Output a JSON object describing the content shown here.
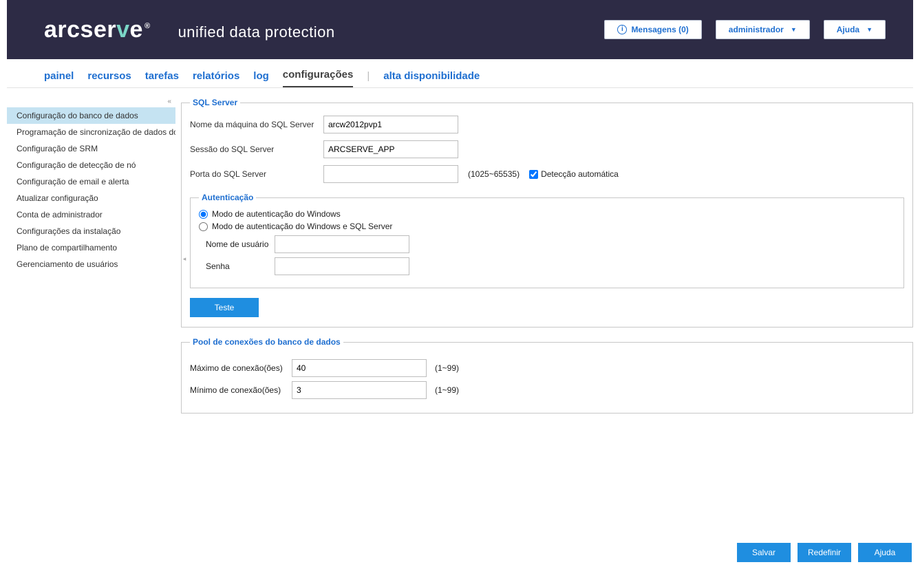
{
  "header": {
    "brand_main_a": "arcser",
    "brand_main_v": "v",
    "brand_main_e": "e",
    "brand_reg": "®",
    "brand_sub": "unified data protection",
    "messages_label": "Mensagens (0)",
    "admin_label": "administrador",
    "help_label": "Ajuda"
  },
  "nav": {
    "items": [
      {
        "label": "painel"
      },
      {
        "label": "recursos"
      },
      {
        "label": "tarefas"
      },
      {
        "label": "relatórios"
      },
      {
        "label": "log"
      },
      {
        "label": "configurações"
      },
      {
        "label": "alta disponibilidade"
      }
    ]
  },
  "sidebar": {
    "collapse_glyph": "«",
    "grip_glyph": "◂",
    "items": [
      "Configuração do banco de dados",
      "Programação de sincronização de dados do",
      "Configuração de SRM",
      "Configuração de detecção de nó",
      "Configuração de email e alerta",
      "Atualizar configuração",
      "Conta de administrador",
      "Configurações da instalação",
      "Plano de compartilhamento",
      "Gerenciamento de usuários"
    ]
  },
  "sql": {
    "legend": "SQL Server",
    "machine_label": "Nome da máquina do SQL Server",
    "machine_value": "arcw2012pvp1",
    "session_label": "Sessão do SQL Server",
    "session_value": "ARCSERVE_APP",
    "port_label": "Porta do SQL Server",
    "port_value": "",
    "port_hint": "(1025~65535)",
    "autodetect_label": "Detecção automática"
  },
  "auth": {
    "legend": "Autenticação",
    "radio_windows": "Modo de autenticação do Windows",
    "radio_mixed": "Modo de autenticação do Windows e SQL Server",
    "user_label": "Nome de usuário",
    "user_value": "",
    "pass_label": "Senha",
    "pass_value": "",
    "test_label": "Teste"
  },
  "pool": {
    "legend": "Pool de conexões do banco de dados",
    "max_label": "Máximo de conexão(ões)",
    "max_value": "40",
    "min_label": "Mínimo de conexão(ões)",
    "min_value": "3",
    "hint": "(1~99)"
  },
  "footer": {
    "save": "Salvar",
    "reset": "Redefinir",
    "help": "Ajuda"
  }
}
